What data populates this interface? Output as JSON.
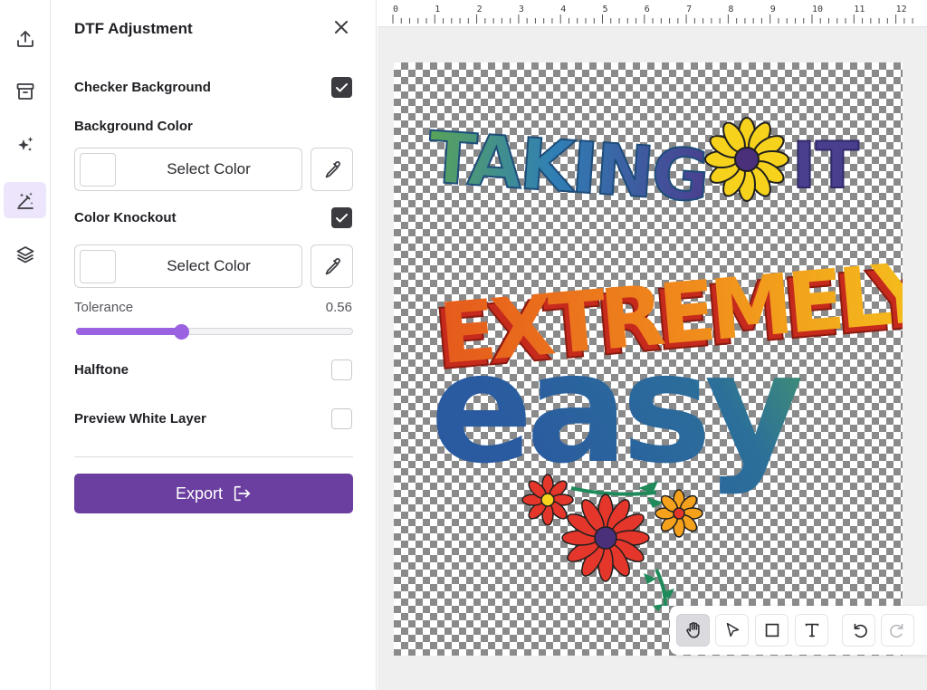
{
  "rail": {
    "items": [
      {
        "icon": "upload-icon",
        "active": false
      },
      {
        "icon": "archive-icon",
        "active": false
      },
      {
        "icon": "sparkles-icon",
        "active": false
      },
      {
        "icon": "magic-wand-icon",
        "active": true
      },
      {
        "icon": "layers-icon",
        "active": false
      }
    ]
  },
  "panel": {
    "title": "DTF Adjustment",
    "checker_background": {
      "label": "Checker Background",
      "checked": true
    },
    "background_color": {
      "label": "Background Color",
      "select_label": "Select Color",
      "swatch_color": "#ffffff"
    },
    "color_knockout": {
      "label": "Color Knockout",
      "checked": true,
      "select_label": "Select Color",
      "swatch_color": "#ffffff"
    },
    "tolerance": {
      "label": "Tolerance",
      "value": "0.56",
      "fraction": 0.38
    },
    "halftone": {
      "label": "Halftone",
      "checked": false
    },
    "preview_white_layer": {
      "label": "Preview White Layer",
      "checked": false
    },
    "export": {
      "label": "Export"
    }
  },
  "ruler": {
    "labels": [
      "0",
      "1",
      "2",
      "3",
      "4",
      "5",
      "6",
      "7",
      "8",
      "9",
      "10",
      "11",
      "12"
    ]
  },
  "artwork": {
    "line1": "TAKING",
    "line1b": "IT",
    "line2": "EXTREMELY",
    "line3": "easy"
  },
  "toolbar": {
    "tools": [
      "hand-tool",
      "select-tool",
      "rectangle-tool",
      "text-tool",
      "undo",
      "redo"
    ],
    "active": "hand-tool"
  },
  "colors": {
    "accent": "#6b3fa0",
    "slider": "#9a62e0",
    "rail_active": "#ece5fb"
  }
}
